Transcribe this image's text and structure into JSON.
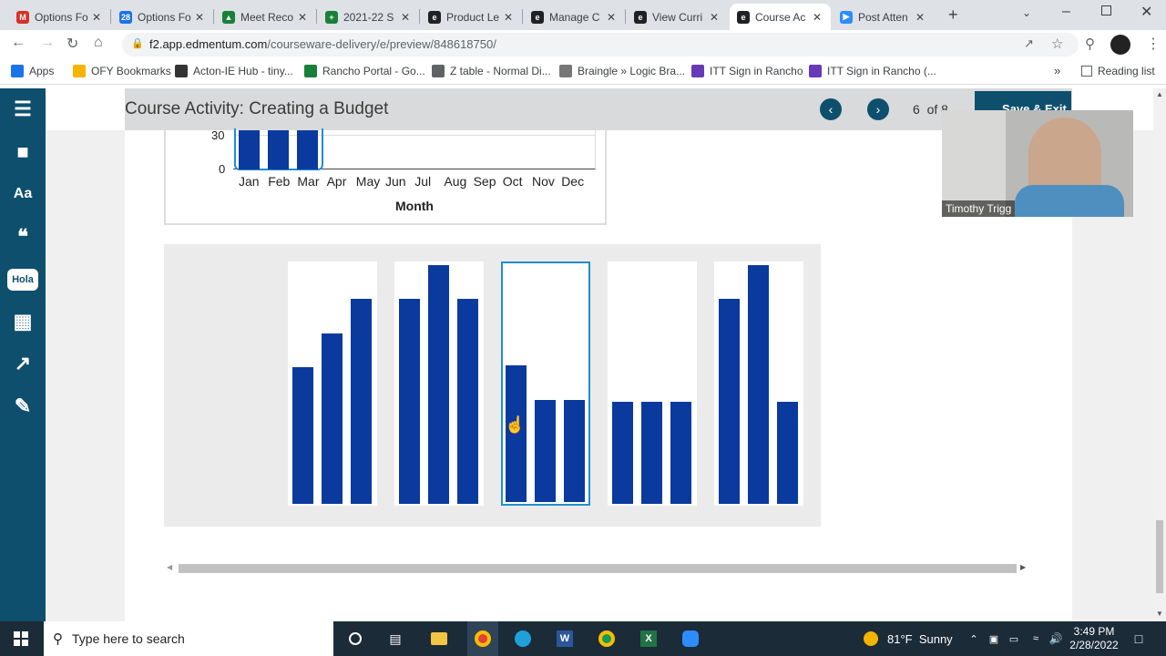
{
  "browser": {
    "tabs": [
      {
        "title": "Options Fo",
        "icon": "gmail-icon",
        "color": "#d93025",
        "glyph": "M"
      },
      {
        "title": "Options Fo",
        "icon": "calendar-icon",
        "color": "#1a73e8",
        "glyph": "28"
      },
      {
        "title": "Meet Reco",
        "icon": "drive-icon",
        "color": "#188038",
        "glyph": "▲"
      },
      {
        "title": "2021-22 S",
        "icon": "sheets-icon",
        "color": "#188038",
        "glyph": "+"
      },
      {
        "title": "Product Le",
        "icon": "edmentum-icon",
        "color": "#202124",
        "glyph": "e"
      },
      {
        "title": "Manage C",
        "icon": "edmentum-icon",
        "color": "#202124",
        "glyph": "e"
      },
      {
        "title": "View Curri",
        "icon": "edmentum-icon",
        "color": "#202124",
        "glyph": "e"
      },
      {
        "title": "Course Ac",
        "icon": "edmentum-icon",
        "color": "#202124",
        "glyph": "e"
      },
      {
        "title": "Post Atten",
        "icon": "zoom-icon",
        "color": "#2d8cff",
        "glyph": "▶"
      }
    ],
    "url_host": "f2.app.edmentum.com",
    "url_path": "/courseware-delivery/e/preview/848618750/",
    "bookmarks": [
      {
        "label": "Apps",
        "icon": "apps-grid-icon",
        "color": "#1a73e8"
      },
      {
        "label": "OFY Bookmarks",
        "icon": "folder-icon",
        "color": "#f4b400"
      },
      {
        "label": "Acton-IE Hub - tiny...",
        "icon": "acton-icon",
        "color": "#333333"
      },
      {
        "label": "Rancho Portal - Go...",
        "icon": "sheets-icon",
        "color": "#188038"
      },
      {
        "label": "Z table - Normal Di...",
        "icon": "globe-icon",
        "color": "#5f6368"
      },
      {
        "label": "Braingle » Logic Bra...",
        "icon": "braingle-icon",
        "color": "#777777"
      },
      {
        "label": "ITT Sign in Rancho",
        "icon": "forms-icon",
        "color": "#673ab7"
      },
      {
        "label": "ITT Sign in Rancho (...",
        "icon": "forms-icon",
        "color": "#673ab7"
      }
    ],
    "reading_list": "Reading list"
  },
  "course": {
    "title": "Course Activity: Creating a Budget",
    "page_current": "6",
    "page_of": "of",
    "page_total": "8",
    "save_exit": "Save & Exit"
  },
  "rail": [
    {
      "icon": "menu-icon"
    },
    {
      "icon": "folder-icon"
    },
    {
      "icon": "dictionary-icon"
    },
    {
      "icon": "audio-icon"
    },
    {
      "icon": "translate-icon",
      "label": "Hola"
    },
    {
      "icon": "calculator-icon"
    },
    {
      "icon": "graph-icon"
    },
    {
      "icon": "highlighter-icon"
    }
  ],
  "top_chart": {
    "xlabel": "Month",
    "yticks": [
      "30",
      "0"
    ],
    "months": [
      "Jan",
      "Feb",
      "Mar",
      "Apr",
      "May",
      "Jun",
      "Jul",
      "Aug",
      "Sep",
      "Oct",
      "Nov",
      "Dec"
    ]
  },
  "chart_data": [
    {
      "type": "bar",
      "name": "option-1",
      "values": [
        4,
        5,
        6
      ]
    },
    {
      "type": "bar",
      "name": "option-2",
      "values": [
        6,
        7,
        6
      ]
    },
    {
      "type": "bar",
      "name": "option-3",
      "values": [
        4,
        3,
        3
      ],
      "selected": true
    },
    {
      "type": "bar",
      "name": "option-4",
      "values": [
        3,
        3,
        3
      ]
    },
    {
      "type": "bar",
      "name": "option-5",
      "values": [
        6,
        7,
        3
      ]
    }
  ],
  "options_scale_max": 7,
  "camera": {
    "name": "Timothy Trigg"
  },
  "taskbar": {
    "search_placeholder": "Type here to search",
    "weather": "81°F  Sunny",
    "time": "3:49 PM",
    "date": "2/28/2022"
  },
  "colors": {
    "bar": "#0a3a9e",
    "accent": "#0e4f6e",
    "selected": "#1e8fd1"
  }
}
